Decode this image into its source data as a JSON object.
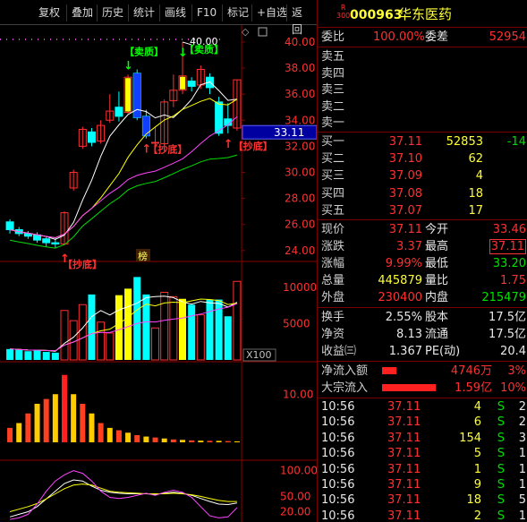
{
  "toolbar": {
    "items": [
      "复权",
      "叠加",
      "历史",
      "统计",
      "画线",
      "F10",
      "标记",
      "+自选",
      "返回"
    ]
  },
  "stock": {
    "badge_top": "R",
    "badge_bottom": "300",
    "code": "000963",
    "name": "华东医药"
  },
  "order": {
    "weibi_label": "委比",
    "weibi_value": "100.00%",
    "weicha_label": "委差",
    "weicha_value": "52954",
    "sell": [
      {
        "label": "卖五",
        "price": "",
        "vol": ""
      },
      {
        "label": "卖四",
        "price": "",
        "vol": ""
      },
      {
        "label": "卖三",
        "price": "",
        "vol": ""
      },
      {
        "label": "卖二",
        "price": "",
        "vol": ""
      },
      {
        "label": "卖一",
        "price": "",
        "vol": ""
      }
    ],
    "buy": [
      {
        "label": "买一",
        "price": "37.11",
        "vol": "52853",
        "chg": "-14"
      },
      {
        "label": "买二",
        "price": "37.10",
        "vol": "62",
        "chg": ""
      },
      {
        "label": "买三",
        "price": "37.09",
        "vol": "4",
        "chg": ""
      },
      {
        "label": "买四",
        "price": "37.08",
        "vol": "18",
        "chg": ""
      },
      {
        "label": "买五",
        "price": "37.07",
        "vol": "17",
        "chg": ""
      }
    ]
  },
  "quote": {
    "xianjia_label": "现价",
    "xianjia": "37.11",
    "jinkai_label": "今开",
    "jinkai": "33.46",
    "zhangdie_label": "涨跌",
    "zhangdie": "3.37",
    "zuigao_label": "最高",
    "zuigao": "37.11",
    "zhangfu_label": "涨幅",
    "zhangfu": "9.99%",
    "zuidi_label": "最低",
    "zuidi": "33.20",
    "zongliang_label": "总量",
    "zongliang": "445879",
    "liangbi_label": "量比",
    "liangbi": "1.75",
    "waipan_label": "外盘",
    "waipan": "230400",
    "neipan_label": "内盘",
    "neipan": "215479",
    "huanshou_label": "换手",
    "huanshou": "2.55%",
    "guben_label": "股本",
    "guben": "17.5亿",
    "jingzi_label": "净资",
    "jingzi": "8.13",
    "liutong_label": "流通",
    "liutong": "17.5亿",
    "shouyi_label": "收益㈢",
    "shouyi": "1.367",
    "pe_label": "PE(动)",
    "pe": "20.4"
  },
  "flow": {
    "net_label": "净流入额",
    "net_value": "4746万",
    "net_pct": "3%",
    "big_label": "大宗流入",
    "big_value": "1.59亿",
    "big_pct": "10%"
  },
  "ticks": [
    {
      "time": "10:56",
      "price": "37.11",
      "vol": "4",
      "side": "S",
      "num": "2"
    },
    {
      "time": "10:56",
      "price": "37.11",
      "vol": "6",
      "side": "S",
      "num": "2"
    },
    {
      "time": "10:56",
      "price": "37.11",
      "vol": "154",
      "side": "S",
      "num": "3"
    },
    {
      "time": "10:56",
      "price": "37.11",
      "vol": "5",
      "side": "S",
      "num": "1"
    },
    {
      "time": "10:56",
      "price": "37.11",
      "vol": "1",
      "side": "S",
      "num": "1"
    },
    {
      "time": "10:56",
      "price": "37.11",
      "vol": "9",
      "side": "S",
      "num": "1"
    },
    {
      "time": "10:56",
      "price": "37.11",
      "vol": "18",
      "side": "S",
      "num": "5"
    },
    {
      "time": "10:56",
      "price": "37.11",
      "vol": "2",
      "side": "S",
      "num": "1"
    }
  ],
  "chart_data": {
    "type": "candlestick",
    "price_axis": {
      "ticks": [
        "40.00",
        "38.00",
        "36.00",
        "34.00",
        "32.00",
        "30.00",
        "28.00",
        "26.00",
        "24.00"
      ],
      "range": [
        23.3,
        41.3
      ]
    },
    "current_price_label": "33.11",
    "high_marker": "40.00",
    "annotations": [
      "【卖质】",
      "【卖质】",
      "【抄底】",
      "【抄底】",
      "【抄底】"
    ],
    "bang_label": "榜",
    "vol_axis": {
      "ticks": [
        "10000",
        "5000"
      ],
      "unit": "X100"
    },
    "indicator_axis": {
      "ticks": [
        "10.00"
      ]
    },
    "kdj_axis": {
      "ticks": [
        "100.00",
        "50.00",
        "20.00"
      ]
    },
    "candles": [
      {
        "o": 26.2,
        "c": 25.6,
        "h": 26.4,
        "l": 25.3
      },
      {
        "o": 25.6,
        "c": 25.3,
        "h": 25.8,
        "l": 25.1
      },
      {
        "o": 25.3,
        "c": 25.1,
        "h": 25.5,
        "l": 24.9
      },
      {
        "o": 25.2,
        "c": 24.8,
        "h": 25.4,
        "l": 24.6
      },
      {
        "o": 24.9,
        "c": 24.6,
        "h": 25.1,
        "l": 24.3
      },
      {
        "o": 24.6,
        "c": 24.5,
        "h": 25.0,
        "l": 24.2
      },
      {
        "o": 24.5,
        "c": 26.9,
        "h": 27.0,
        "l": 24.4
      },
      {
        "o": 28.8,
        "c": 30.0,
        "h": 30.2,
        "l": 28.6
      },
      {
        "o": 32.0,
        "c": 33.3,
        "h": 33.5,
        "l": 31.8
      },
      {
        "o": 33.1,
        "c": 32.3,
        "h": 33.4,
        "l": 32.0
      },
      {
        "o": 32.4,
        "c": 33.6,
        "h": 34.0,
        "l": 32.2
      },
      {
        "o": 34.0,
        "c": 34.7,
        "h": 36.0,
        "l": 33.8
      },
      {
        "o": 35.0,
        "c": 34.3,
        "h": 36.2,
        "l": 33.9
      },
      {
        "o": 34.6,
        "c": 37.3,
        "h": 37.5,
        "l": 34.5
      },
      {
        "o": 37.6,
        "c": 34.2,
        "h": 37.9,
        "l": 34.0
      },
      {
        "o": 34.3,
        "c": 32.8,
        "h": 34.8,
        "l": 32.6
      },
      {
        "o": 32.3,
        "c": 32.3,
        "h": 33.5,
        "l": 31.8
      },
      {
        "o": 32.2,
        "c": 35.4,
        "h": 35.6,
        "l": 31.6
      },
      {
        "o": 35.5,
        "c": 36.3,
        "h": 37.5,
        "l": 35.0
      },
      {
        "o": 36.3,
        "c": 37.4,
        "h": 40.0,
        "l": 36.0
      },
      {
        "o": 37.0,
        "c": 36.6,
        "h": 37.3,
        "l": 36.2
      },
      {
        "o": 36.7,
        "c": 37.9,
        "h": 38.2,
        "l": 36.4
      },
      {
        "o": 37.3,
        "c": 36.5,
        "h": 37.6,
        "l": 36.0
      },
      {
        "o": 35.4,
        "c": 33.0,
        "h": 35.8,
        "l": 32.8
      },
      {
        "o": 34.1,
        "c": 33.6,
        "h": 35.3,
        "l": 33.0
      },
      {
        "o": 33.4,
        "c": 37.1,
        "h": 37.1,
        "l": 33.2
      }
    ],
    "volumes": [
      1500,
      1400,
      1200,
      1300,
      1100,
      1000,
      6800,
      5400,
      7600,
      9000,
      5200,
      3700,
      8900,
      9800,
      11400,
      9000,
      4400,
      9300,
      8700,
      8400,
      7600,
      6200,
      8300,
      8300,
      6000,
      10800
    ]
  }
}
